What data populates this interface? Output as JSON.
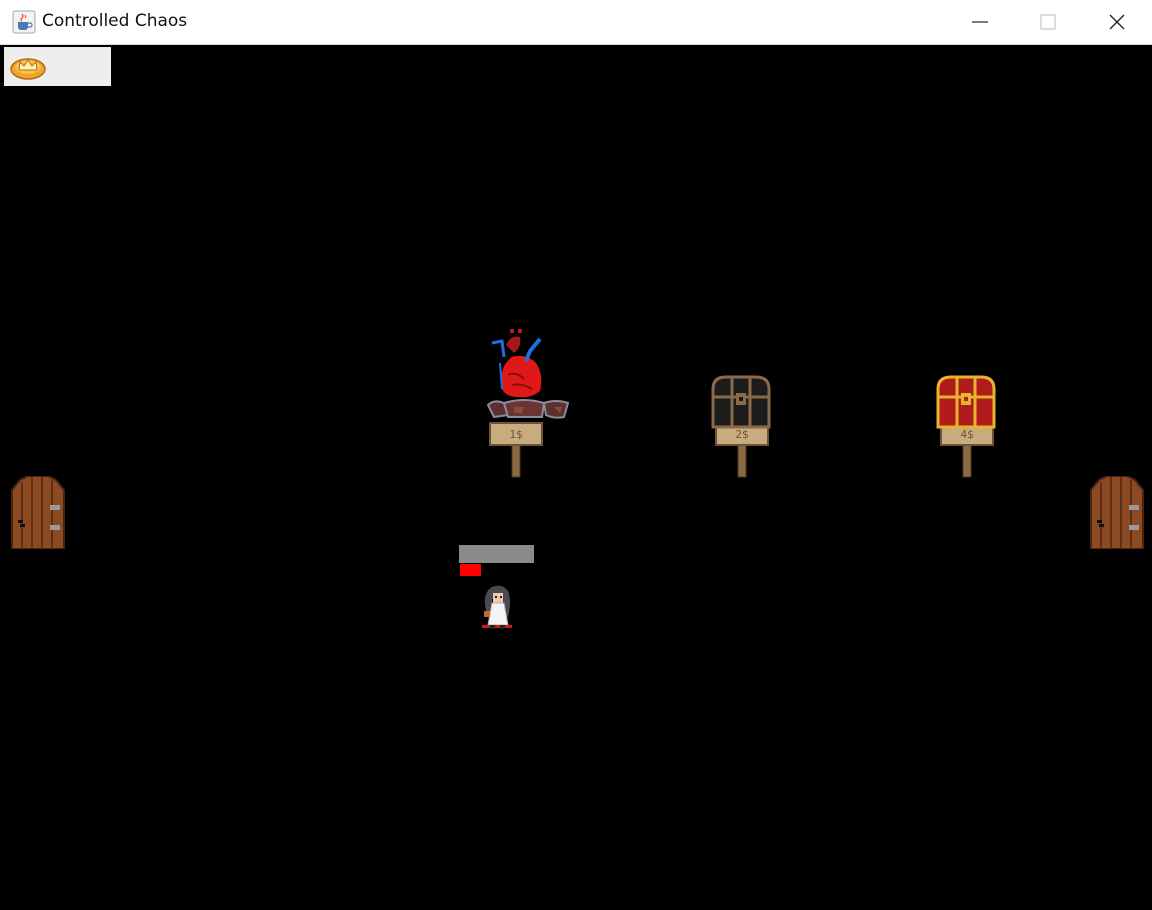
{
  "window": {
    "title": "Controlled Chaos",
    "app_icon": "java-cup-icon",
    "controls": [
      "minimize-icon",
      "maximize-icon",
      "close-icon"
    ]
  },
  "hud": {
    "currency_icon": "crown-coin-icon",
    "coin_count": ""
  },
  "shop": {
    "items": [
      {
        "item": "anatomical-heart",
        "price": "1$"
      },
      {
        "item": "black-chest",
        "price": "2$"
      },
      {
        "item": "red-gold-chest",
        "price": "4$"
      }
    ]
  },
  "player": {
    "health_fraction": 0.28,
    "health_bar_color": "#ff0000",
    "health_bar_bg_color": "#8a8a8a"
  },
  "doors": [
    "left-door",
    "right-door"
  ],
  "colors": {
    "background": "#000000",
    "hud_bg": "#eeeeee",
    "wood": "#8b4a22",
    "gold": "#e6b52a",
    "chest_red": "#b01c1c"
  }
}
